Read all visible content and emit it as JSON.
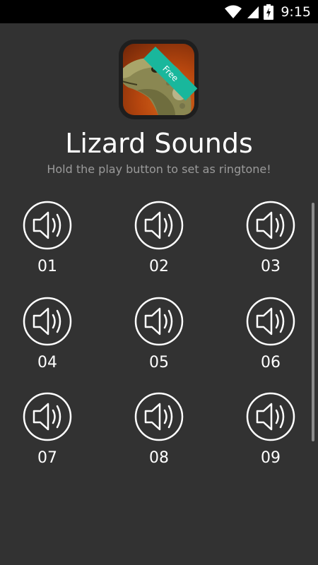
{
  "status_bar": {
    "time": "9:15",
    "icons": [
      "wifi-icon",
      "signal-icon",
      "battery-charging-icon"
    ]
  },
  "app": {
    "title": "Lizard Sounds",
    "subtitle": "Hold the play button to set as ringtone!",
    "badge": "Free",
    "icon_name": "lizard-app-icon"
  },
  "colors": {
    "background": "#323232",
    "status_bar": "#000000",
    "badge": "#19b79c",
    "subtitle": "#9a9a9a"
  },
  "sounds": [
    {
      "label": "01",
      "icon": "speaker-icon"
    },
    {
      "label": "02",
      "icon": "speaker-icon"
    },
    {
      "label": "03",
      "icon": "speaker-icon"
    },
    {
      "label": "04",
      "icon": "speaker-icon"
    },
    {
      "label": "05",
      "icon": "speaker-icon"
    },
    {
      "label": "06",
      "icon": "speaker-icon"
    },
    {
      "label": "07",
      "icon": "speaker-icon"
    },
    {
      "label": "08",
      "icon": "speaker-icon"
    },
    {
      "label": "09",
      "icon": "speaker-icon"
    }
  ]
}
